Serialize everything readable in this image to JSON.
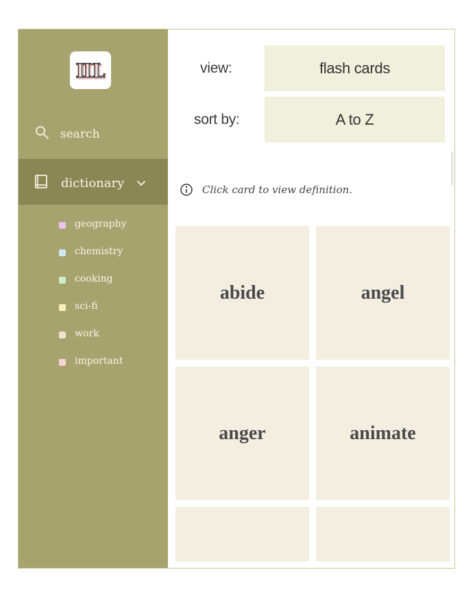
{
  "sidebar": {
    "logo_text": "ⅡL",
    "search_label": "search",
    "dictionary_label": "dictionary",
    "tags": [
      {
        "label": "geography",
        "color": "#e6c6ea"
      },
      {
        "label": "chemistry",
        "color": "#cfe8f2"
      },
      {
        "label": "cooking",
        "color": "#cdeec9"
      },
      {
        "label": "sci-fi",
        "color": "#f6f2b8"
      },
      {
        "label": "work",
        "color": "#f3e2cc"
      },
      {
        "label": "important",
        "color": "#f5d3d6"
      }
    ]
  },
  "controls": {
    "view_label": "view:",
    "view_value": "flash cards",
    "sort_label": "sort by:",
    "sort_value": "A to Z"
  },
  "info_text": "Click card to view definition.",
  "cards": [
    {
      "word": "abide"
    },
    {
      "word": "angel"
    },
    {
      "word": "anger"
    },
    {
      "word": "animate"
    },
    {
      "word": ""
    },
    {
      "word": ""
    }
  ],
  "colors": {
    "sidebar_bg": "#a7a36e",
    "sidebar_active": "#8b8754",
    "select_bg": "#f1f0dc",
    "card_bg": "#f3eee0"
  },
  "icons": {
    "logo": "logo-icon",
    "search": "search-icon",
    "dictionary": "book-icon",
    "chevron": "chevron-down-icon",
    "info": "info-icon"
  }
}
